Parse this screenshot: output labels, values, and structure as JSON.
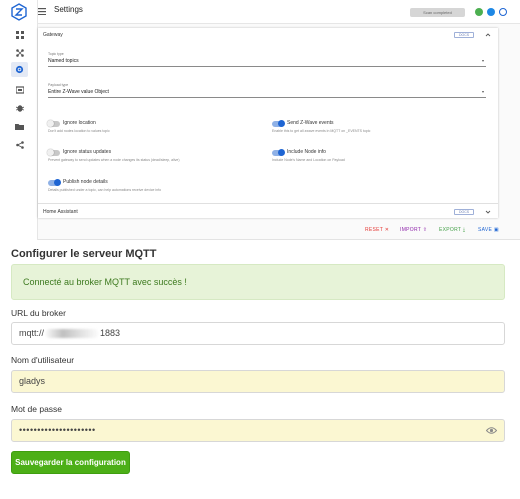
{
  "zwave": {
    "title": "Settings",
    "scan_status": "Scan completed",
    "status_colors": {
      "ok": "#4caf50",
      "info": "#1e88e5",
      "history": "#1e65d3"
    },
    "gateway": {
      "section_title": "Gateway",
      "docs_label": "DOCS",
      "topic_type_label": "Topic type",
      "topic_type_value": "Named topics",
      "payload_type_label": "Payload type",
      "payload_type_value": "Entire Z-Wave value Object",
      "toggles": [
        {
          "label": "Ignore location",
          "hint": "Don't add nodes location to values topic",
          "on": false
        },
        {
          "label": "Send Z-Wave events",
          "hint": "Enable this to get all zwave events in MQTT on _EVENTS topic",
          "on": true
        },
        {
          "label": "Ignore status updates",
          "hint": "Prevent gateway to send updates when a node changes its status (dead/sleep, alive)",
          "on": false
        },
        {
          "label": "Include Node info",
          "hint": "Include Node's Name and Location on Payload",
          "on": true
        },
        {
          "label": "Publish node details",
          "hint": "Details published under a topic, can help automations receive device info",
          "on": true
        }
      ]
    },
    "home_assistant": {
      "section_title": "Home Assistant",
      "docs_label": "DOCS"
    },
    "actions": {
      "reset": "RESET",
      "import": "IMPORT",
      "export": "EXPORT",
      "save": "SAVE"
    },
    "action_colors": {
      "reset": "#e53935",
      "import": "#8e24aa",
      "export": "#43a047",
      "save": "#1e65d3"
    }
  },
  "mqtt_form": {
    "title": "Configurer le serveur MQTT",
    "success_message": "Connecté au broker MQTT avec succès !",
    "broker_label": "URL du broker",
    "broker_prefix": "mqtt://",
    "broker_suffix": "1883",
    "username_label": "Nom d'utilisateur",
    "username_value": "gladys",
    "password_label": "Mot de passe",
    "password_value": "•••••••••••••••••••••",
    "save_button": "Sauvegarder la configuration",
    "accent_color": "#4caf17"
  }
}
